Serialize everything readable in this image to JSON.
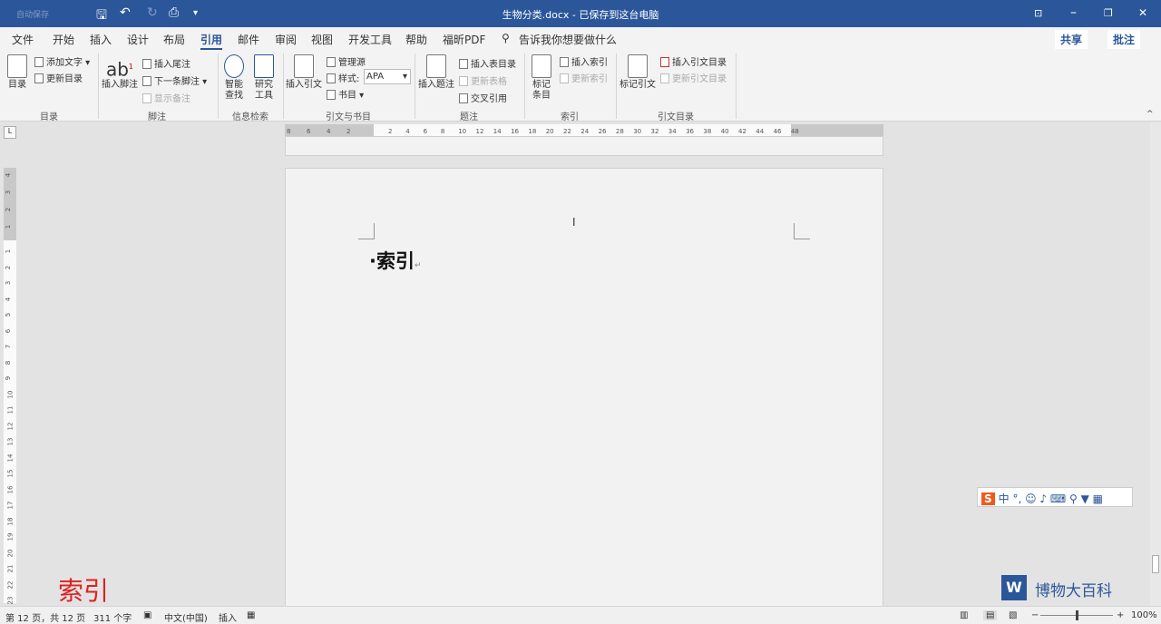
{
  "title_bar": {
    "autosave": "自动保存",
    "title": "生物分类.docx - 已保存到这台电脑",
    "icons": [
      "save-icon",
      "undo-icon",
      "redo-icon",
      "print-preview-icon",
      "customize-icon"
    ],
    "window_buttons": [
      "ribbon-display-icon",
      "minimize-icon",
      "restore-icon",
      "close-icon"
    ]
  },
  "tabs": [
    "文件",
    "开始",
    "插入",
    "设计",
    "布局",
    "引用",
    "邮件",
    "审阅",
    "视图",
    "开发工具",
    "帮助",
    "福昕PDF"
  ],
  "active_tab": "引用",
  "tell_me": "告诉我你想要做什么",
  "share": "共享",
  "comments": "批注",
  "ribbon": {
    "toc": {
      "big": "目录",
      "add_text": "添加文字",
      "update": "更新目录",
      "group": "目录"
    },
    "footnotes": {
      "big": "插入脚注",
      "endnote": "插入尾注",
      "next": "下一条脚注",
      "show": "显示备注",
      "group": "脚注"
    },
    "research": {
      "smart": "智能\n查找",
      "smart1": "智能",
      "smart2": "查找",
      "tools1": "研究",
      "tools2": "工具",
      "group": "信息检索"
    },
    "citations": {
      "big": "插入引文",
      "manage": "管理源",
      "style_label": "样式:",
      "style_value": "APA",
      "biblio": "书目",
      "group": "引文与书目"
    },
    "captions": {
      "big": "插入题注",
      "table_figs": "插入表目录",
      "update_table": "更新表格",
      "cross_ref": "交叉引用",
      "group": "题注"
    },
    "index": {
      "mark1": "标记",
      "mark2": "条目",
      "insert": "插入索引",
      "update": "更新索引",
      "group": "索引"
    },
    "toa": {
      "mark": "标记引文",
      "insert": "插入引文目录",
      "update": "更新引文目录",
      "group": "引文目录"
    }
  },
  "ruler": {
    "left": [
      "8",
      "6",
      "4",
      "2"
    ],
    "right": [
      "2",
      "4",
      "6",
      "8",
      "10",
      "12",
      "14",
      "16",
      "18",
      "20",
      "22",
      "24",
      "26",
      "28",
      "30",
      "32",
      "34",
      "36",
      "38",
      "40",
      "42",
      "44",
      "46",
      "48"
    ]
  },
  "vruler": [
    "4",
    "3",
    "2",
    "1",
    "1",
    "2",
    "3",
    "4",
    "5",
    "6",
    "7",
    "8",
    "9",
    "10",
    "11",
    "12",
    "13",
    "14",
    "15",
    "16",
    "17",
    "18",
    "19",
    "20",
    "21",
    "22",
    "23"
  ],
  "document": {
    "heading": "索引"
  },
  "overlay": {
    "caption": "索引",
    "watermark": "博物大百科",
    "ime": "中 °, ☺ ♪ ⌨ ⚲ ▼ ▦",
    "caption_color": "#e02020"
  },
  "status": {
    "page": "第 12 页，共 12 页",
    "words": "311 个字",
    "lang": "中文(中国)",
    "mode": "插入",
    "zoom": "100%"
  }
}
